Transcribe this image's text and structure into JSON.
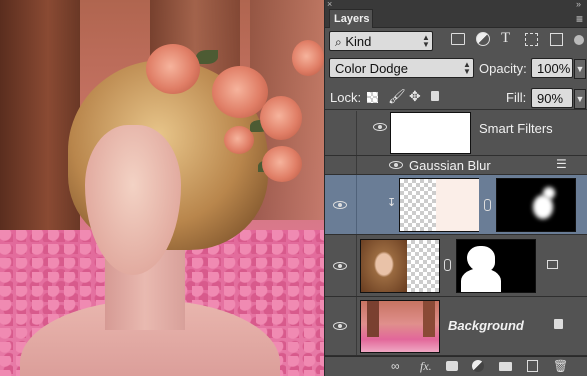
{
  "panel": {
    "tab_label": "Layers",
    "close_glyph": "×",
    "collapse_glyph": "»",
    "menu_glyph": "≡"
  },
  "filter": {
    "kind_label": "Kind",
    "search_glyph": "⌕",
    "icons": [
      "image-filter-icon",
      "adjustment-filter-icon",
      "type-filter-icon",
      "shape-filter-icon",
      "smart-object-filter-icon"
    ]
  },
  "blend": {
    "mode": "Color Dodge",
    "opacity_label": "Opacity:",
    "opacity_value": "100%",
    "lock_label": "Lock:",
    "fill_label": "Fill:",
    "fill_value": "90%"
  },
  "layers": [
    {
      "type": "smart-filters",
      "name": "Smart Filters"
    },
    {
      "type": "filter",
      "name": "Gaussian Blur"
    },
    {
      "type": "clipped-layer",
      "name": ""
    },
    {
      "type": "smart-object",
      "name": ""
    },
    {
      "type": "background",
      "name": "Background"
    }
  ],
  "footer": {
    "fx_label": "fx."
  },
  "colors": {
    "panel_bg": "#535353",
    "selected_layer": "#6a7d96",
    "input_bg": "#dcdcdc"
  }
}
